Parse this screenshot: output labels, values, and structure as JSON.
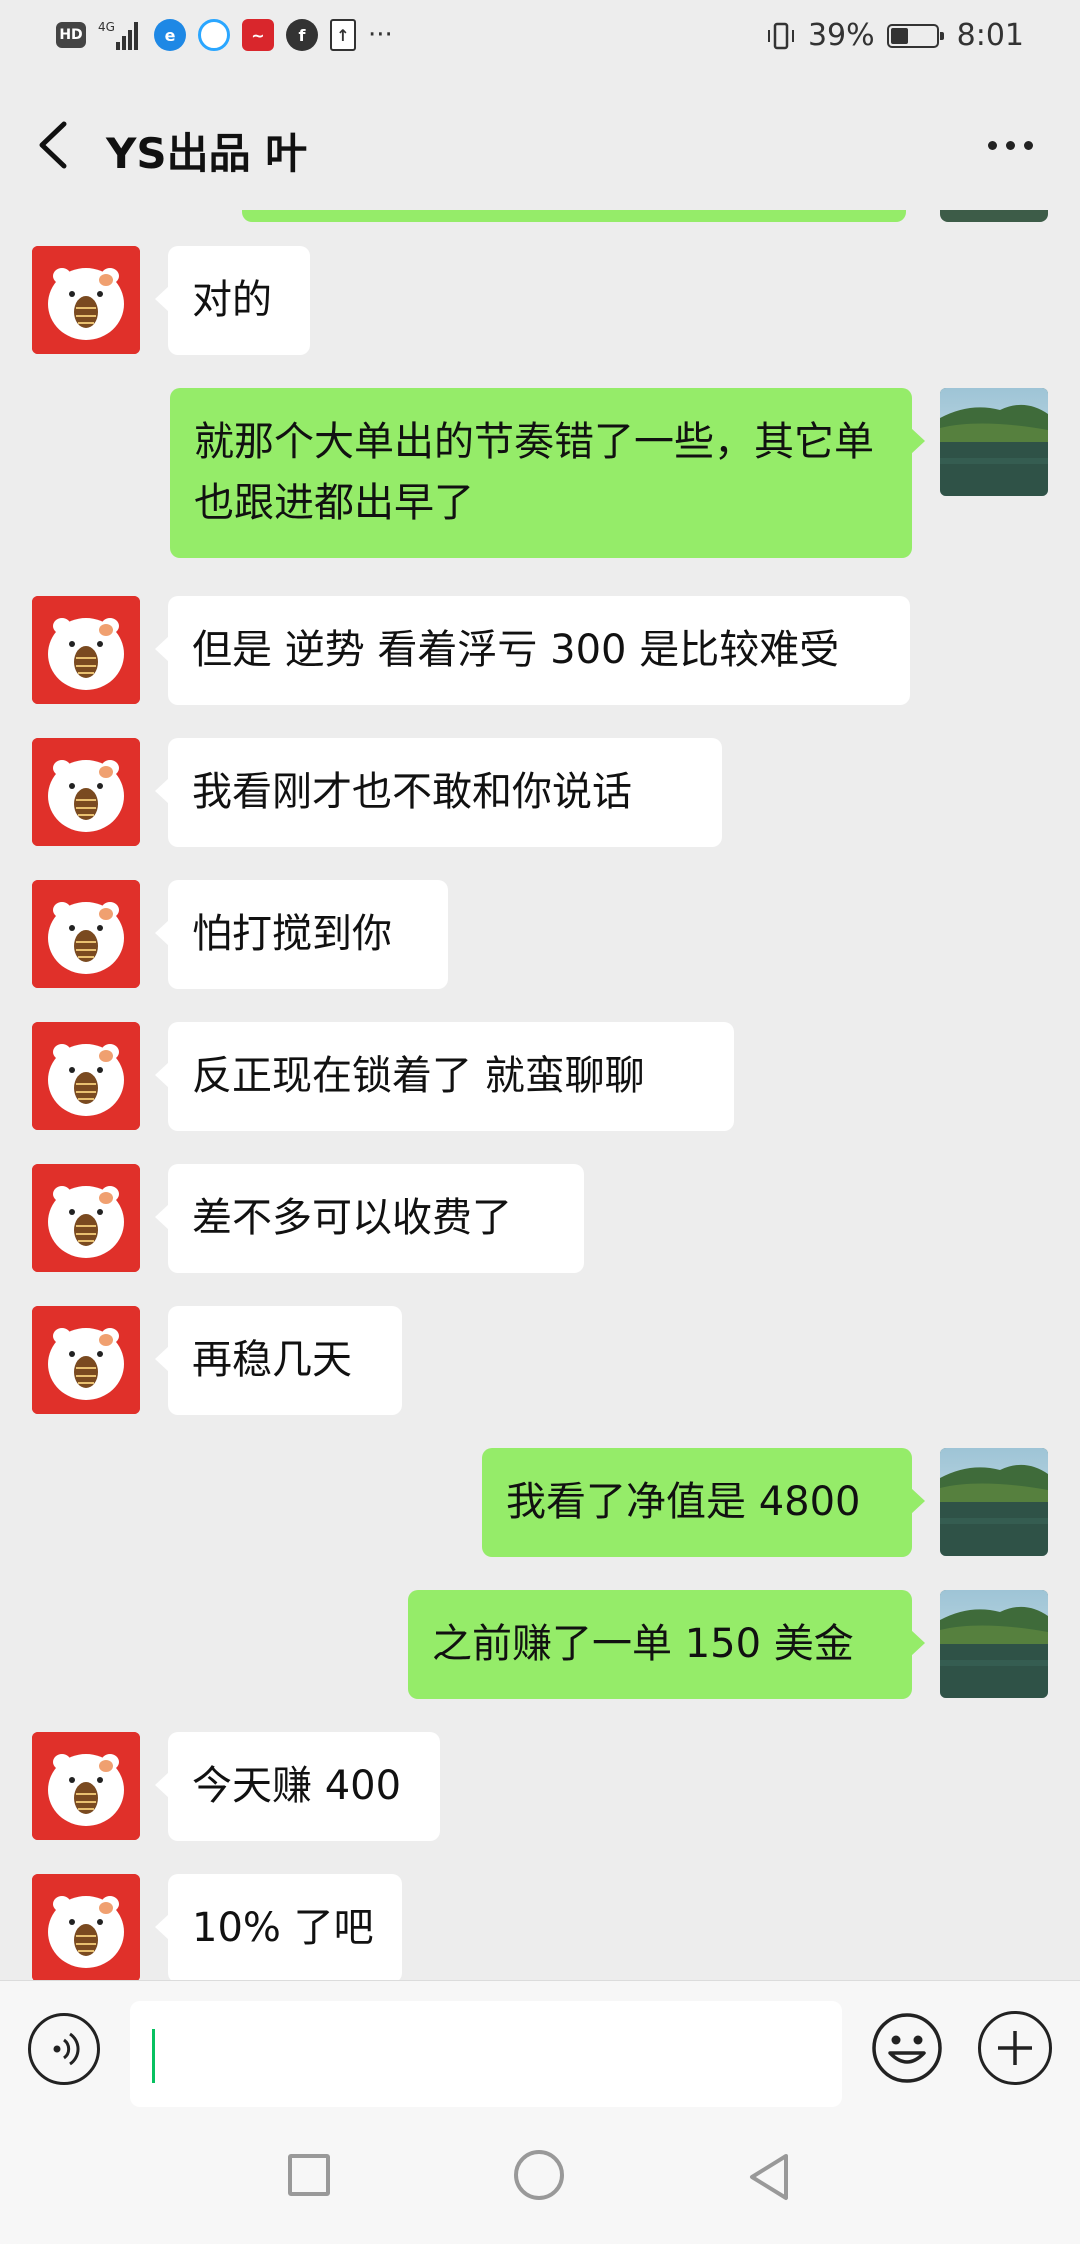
{
  "status_bar": {
    "left_icons": [
      "hd-icon",
      "4g-signal-icon",
      "browser-icon",
      "qq-browser-icon",
      "stock-app-icon",
      "app-icon",
      "upload-icon"
    ],
    "more": "···",
    "battery_percent": "39%",
    "battery_level": 0.39,
    "time": "8:01"
  },
  "header": {
    "title": "YS出品 叶"
  },
  "messages": [
    {
      "side": "left",
      "text": "对的"
    },
    {
      "side": "right",
      "text": "就那个大单出的节奏错了一些，其它单也跟进都出早了"
    },
    {
      "side": "left",
      "text": "但是 逆势 看着浮亏 300 是比较难受"
    },
    {
      "side": "left",
      "text": "我看刚才也不敢和你说话"
    },
    {
      "side": "left",
      "text": "怕打搅到你"
    },
    {
      "side": "left",
      "text": "反正现在锁着了 就蛮聊聊"
    },
    {
      "side": "left",
      "text": "差不多可以收费了"
    },
    {
      "side": "left",
      "text": "再稳几天"
    },
    {
      "side": "right",
      "text": "我看了净值是 4800"
    },
    {
      "side": "right",
      "text": "之前赚了一单 150 美金"
    },
    {
      "side": "left",
      "text": "今天赚 400"
    },
    {
      "side": "left",
      "text": "10% 了吧"
    }
  ],
  "input_bar": {
    "voice_icon": "voice-icon",
    "emoji_icon": "emoji-icon",
    "plus_icon": "plus-icon",
    "value": ""
  },
  "colors": {
    "background": "#ededed",
    "sent_bubble": "#95ec69",
    "received_bubble": "#ffffff",
    "caret": "#07c160"
  }
}
